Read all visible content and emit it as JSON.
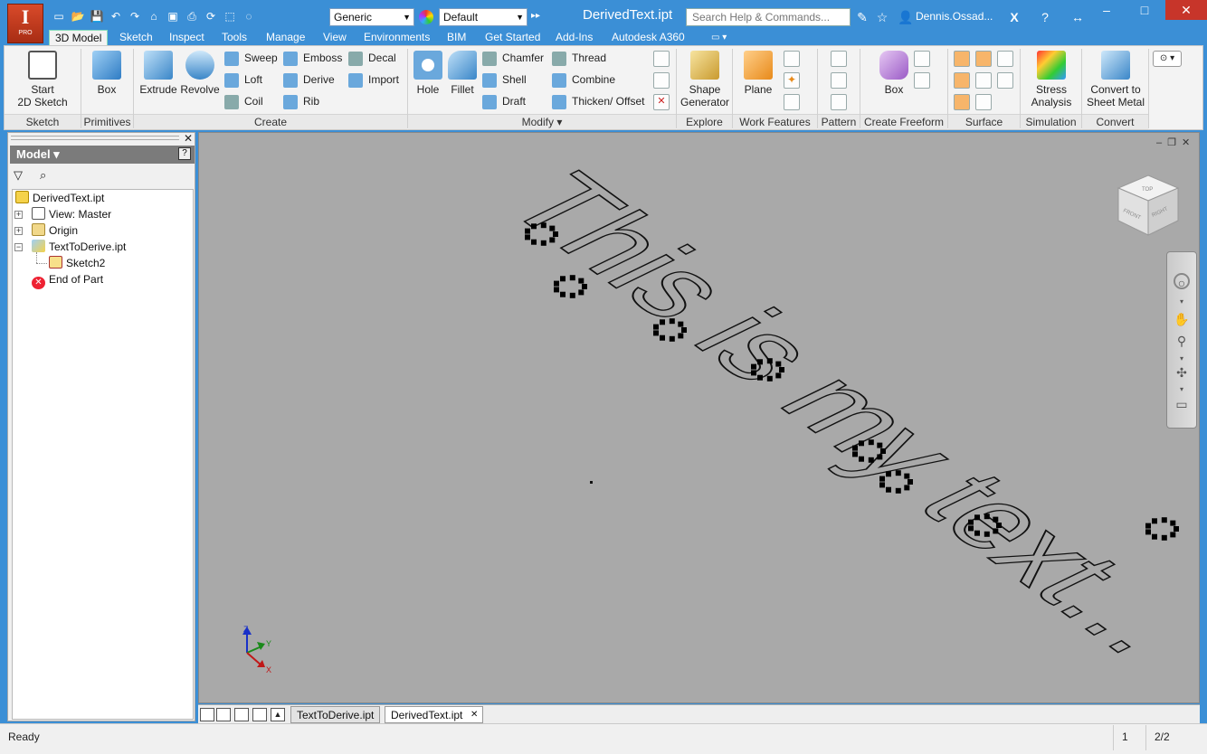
{
  "app": {
    "logo_letter": "I",
    "edition": "PRO",
    "title": "DerivedText.ipt"
  },
  "quick_access": {
    "appearance_value": "Generic",
    "material_value": "Default"
  },
  "search": {
    "placeholder": "Search Help & Commands..."
  },
  "user": {
    "name": "Dennis.Ossad..."
  },
  "menu_tabs": [
    "3D Model",
    "Sketch",
    "Inspect",
    "Tools",
    "Manage",
    "View",
    "Environments",
    "BIM",
    "Get Started",
    "Add-Ins",
    "Autodesk A360"
  ],
  "ribbon": {
    "sketch": {
      "label": "Sketch",
      "start_line1": "Start",
      "start_line2": "2D Sketch"
    },
    "primitives": {
      "label": "Primitives",
      "box": "Box"
    },
    "create": {
      "label": "Create",
      "extrude": "Extrude",
      "revolve": "Revolve",
      "sweep": "Sweep",
      "loft": "Loft",
      "coil": "Coil",
      "emboss": "Emboss",
      "derive": "Derive",
      "rib": "Rib",
      "decal": "Decal",
      "import": "Import"
    },
    "modify": {
      "label": "Modify ▾",
      "hole": "Hole",
      "fillet": "Fillet",
      "chamfer": "Chamfer",
      "shell": "Shell",
      "draft": "Draft",
      "thread": "Thread",
      "combine": "Combine",
      "thicken": "Thicken/ Offset"
    },
    "explore": {
      "label": "Explore",
      "shape_line1": "Shape",
      "shape_line2": "Generator"
    },
    "work_features": {
      "label": "Work Features",
      "plane": "Plane"
    },
    "pattern": {
      "label": "Pattern"
    },
    "freeform": {
      "label": "Create Freeform",
      "box": "Box"
    },
    "surface": {
      "label": "Surface"
    },
    "simulation": {
      "label": "Simulation",
      "stress_line1": "Stress",
      "stress_line2": "Analysis"
    },
    "convert": {
      "label": "Convert",
      "line1": "Convert to",
      "line2": "Sheet Metal"
    }
  },
  "browser": {
    "title": "Model ▾",
    "tree": [
      {
        "label": "DerivedText.ipt"
      },
      {
        "label": "View: Master"
      },
      {
        "label": "Origin"
      },
      {
        "label": "TextToDerive.ipt"
      },
      {
        "label": "Sketch2"
      },
      {
        "label": "End of Part"
      }
    ]
  },
  "viewport": {
    "sketch_text": "This is my text...",
    "viewcube_faces": [
      "TOP",
      "FRONT",
      "RIGHT"
    ],
    "axes": {
      "x": "X",
      "y": "Y",
      "z": "Z"
    }
  },
  "document_tabs": [
    "TextToDerive.ipt",
    "DerivedText.ipt"
  ],
  "status": {
    "text": "Ready",
    "cell1": "1",
    "cell2": "2/2"
  },
  "colors": {
    "titlebar": "#3b8fd6",
    "app_button": "#c63c1e",
    "viewport": "#a9a9a9"
  }
}
